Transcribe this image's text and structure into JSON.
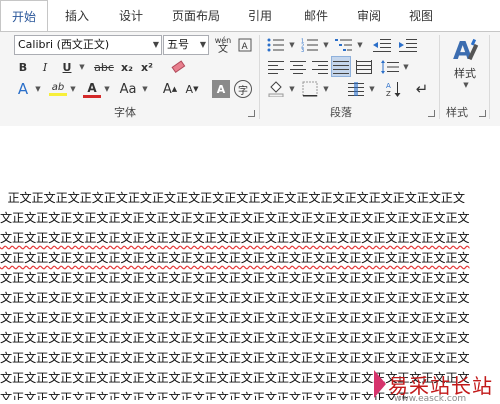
{
  "tabs": [
    "开始",
    "插入",
    "设计",
    "页面布局",
    "引用",
    "邮件",
    "审阅",
    "视图"
  ],
  "font": {
    "name": "Calibri (西文正文)",
    "size": "五号",
    "wen_label": "wén",
    "wen_char": "文",
    "bold": "B",
    "italic": "I",
    "underline": "U",
    "strike": "abc",
    "subscript": "x₂",
    "superscript": "x²",
    "effects": "A",
    "highlight": "ab",
    "font_color": "A",
    "case": "Aa",
    "grow": "A",
    "shrink": "A",
    "shade": "A",
    "enclose": "字",
    "group_label": "字体"
  },
  "paragraph": {
    "group_label": "段落"
  },
  "styles": {
    "label": "样式",
    "group_label": "样式"
  },
  "document": {
    "lines": [
      "  正文正文正文正文正文正文正文正文正文正文正文正文正文正文正文正文正文正文正文",
      "文正文正文正文正文正文正文正文正文正文正文正文正文正文正文正文正文正文正文正文",
      "文正文正文正文正文正文正文正文正文正文正文正文正文正文正文正文正文正文正文正文",
      "文正文正文正文正文正文正文正文正文正文正文正文正文正文正文正文正文正文正文正文",
      "文正文正文正文正文正文正文正文正文正文正文正文正文正文正文正文正文正文正文正文",
      "文正文正文正文正文正文正文正文正文正文正文正文正文正文正文正文正文正文正文正文",
      "文正文正文正文正文正文正文正文正文正文正文正文正文正文正文正文正文正文正文正文",
      "文正文正文正文正文正文正文正文正文正文正文正文正文正文正文正文正文正文正文正文",
      "文正文正文正文正文正文正文正文正文正文正文正文正文正文正文正文正文正文正文正文",
      "文正文正文正文正文正文正文正文正文正文正文正文正文正文正文正文正文正文正文正文",
      "文正文正文正文正文正文正文正文正文正文正文正文正文正文正文正文正文正"
    ]
  },
  "watermark": {
    "text": "易采站长站",
    "url": "www.easck.com"
  },
  "colors": {
    "accent": "#2b579a",
    "highlight": "#f7ef3a",
    "font_color": "#d42a2a",
    "spell": "#e43b3b"
  }
}
